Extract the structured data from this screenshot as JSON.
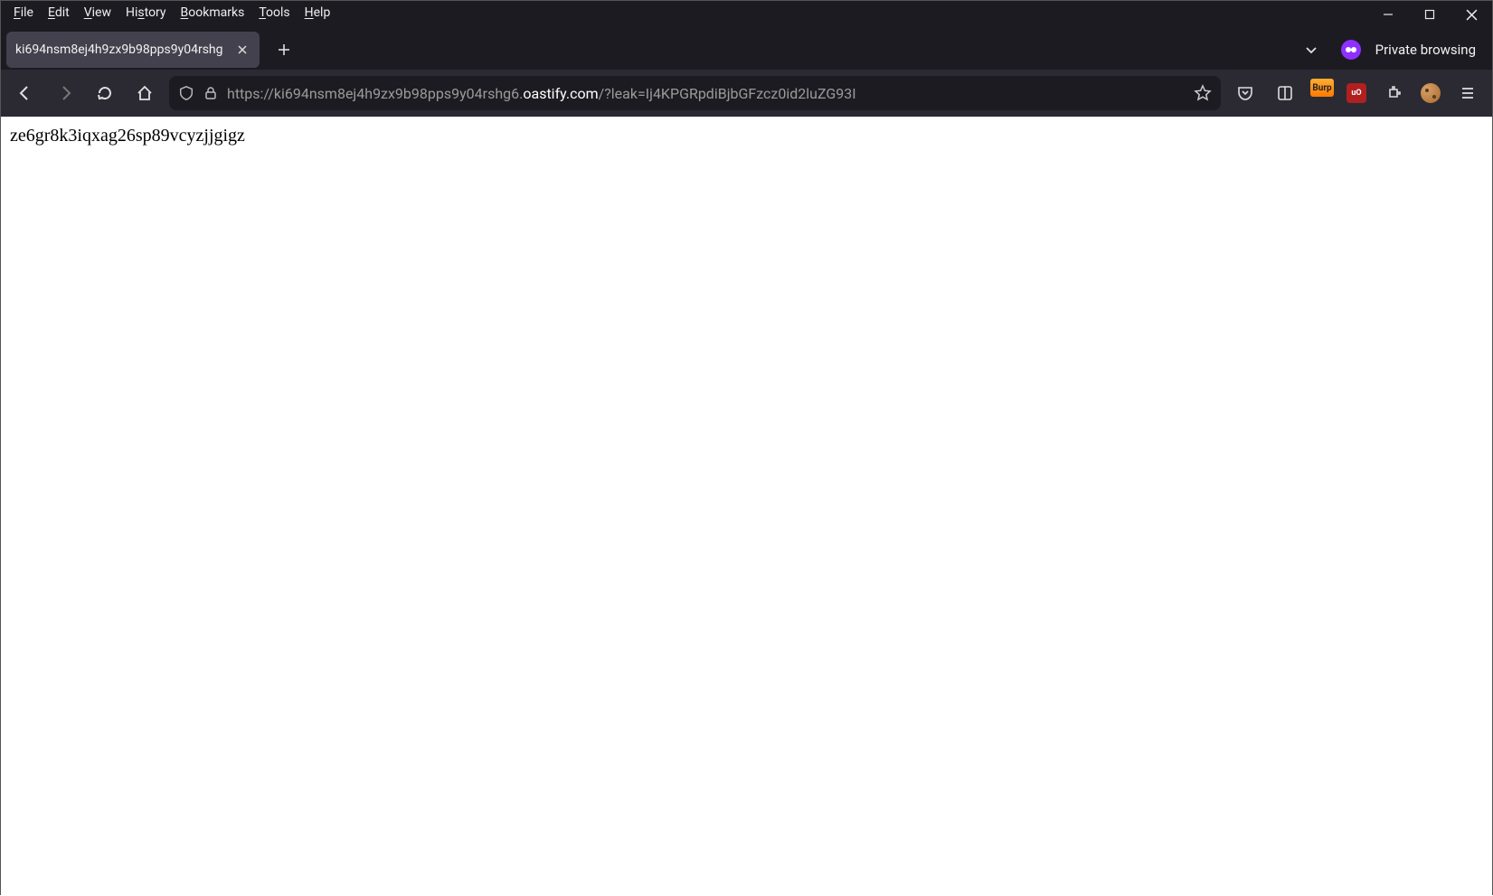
{
  "menubar": {
    "file": "File",
    "edit": "Edit",
    "view": "View",
    "history": "History",
    "bookmarks": "Bookmarks",
    "tools": "Tools",
    "help": "Help"
  },
  "tab": {
    "title": "ki694nsm8ej4h9zx9b98pps9y04rshg"
  },
  "private_label": "Private browsing",
  "url": {
    "pre": "https://ki694nsm8ej4h9zx9b98pps9y04rshg6.",
    "main": "oastify.com",
    "post": "/?leak=Ij4KPGRpdiBjbGFzcz0id2luZG93I"
  },
  "extensions": {
    "burp": "Burp",
    "ublock": "uO"
  },
  "page": {
    "body_text": "ze6gr8k3iqxag26sp89vcyzjjgigz"
  }
}
